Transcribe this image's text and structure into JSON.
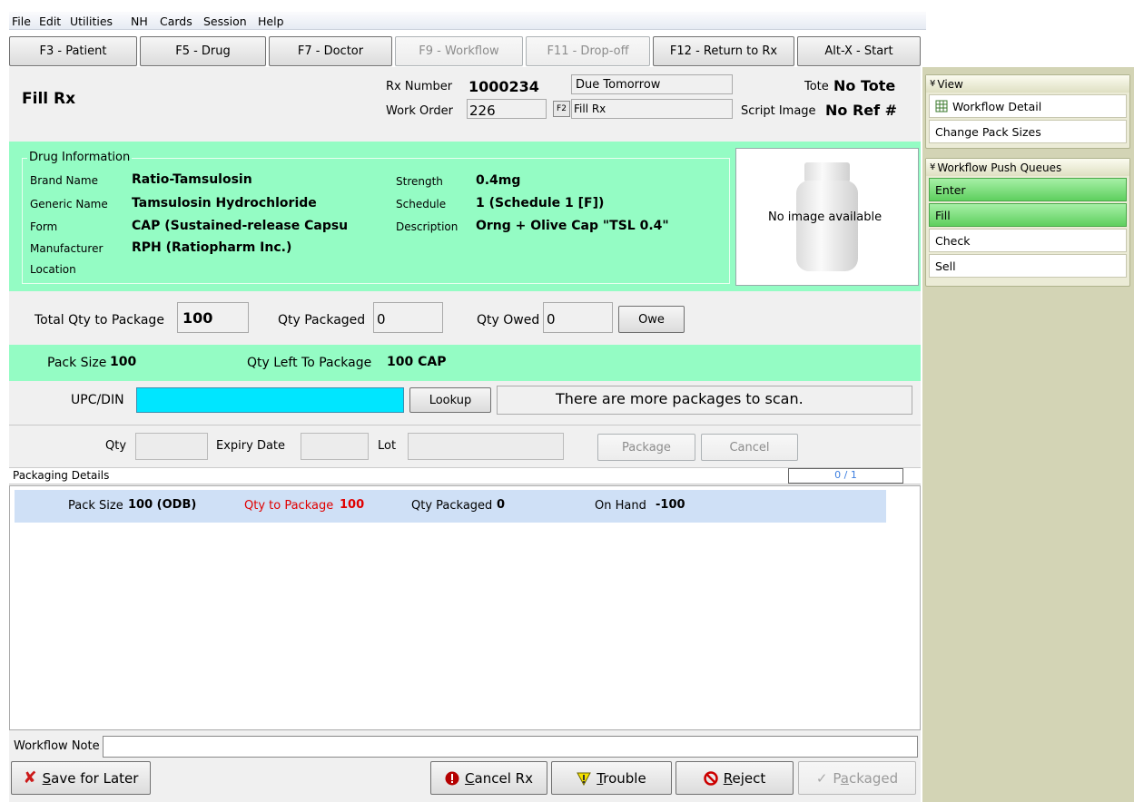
{
  "menu": [
    "File",
    "Edit",
    "Utilities",
    "NH",
    "Cards",
    "Session",
    "Help"
  ],
  "fkeys": [
    {
      "label": "F3 - Patient",
      "enabled": true
    },
    {
      "label": "F5 - Drug",
      "enabled": true
    },
    {
      "label": "F7 - Doctor",
      "enabled": true
    },
    {
      "label": "F9 - Workflow",
      "enabled": false
    },
    {
      "label": "F11 - Drop-off",
      "enabled": false
    },
    {
      "label": "F12 - Return to Rx",
      "enabled": true
    },
    {
      "label": "Alt-X - Start",
      "enabled": true
    }
  ],
  "header": {
    "title": "Fill Rx",
    "rx_number_label": "Rx Number",
    "rx_number": "1000234",
    "due": "Due Tomorrow",
    "work_order_label": "Work Order",
    "work_order": "226",
    "f2_key": "F2",
    "status": "Fill Rx",
    "tote_label": "Tote",
    "tote": "No Tote",
    "script_image_label": "Script Image",
    "script_image": "No Ref #"
  },
  "drug": {
    "section_title": "Drug Information",
    "brand_label": "Brand Name",
    "brand": "Ratio-Tamsulosin",
    "generic_label": "Generic Name",
    "generic": "Tamsulosin Hydrochloride",
    "form_label": "Form",
    "form": "CAP (Sustained-release Capsu",
    "manufacturer_label": "Manufacturer",
    "manufacturer": "RPH (Ratiopharm Inc.)",
    "location_label": "Location",
    "strength_label": "Strength",
    "strength": "0.4mg",
    "schedule_label": "Schedule",
    "schedule": "1 (Schedule 1 [F])",
    "description_label": "Description",
    "description": "Orng + Olive Cap \"TSL 0.4\"",
    "image_text": "No image available"
  },
  "qty": {
    "total_label": "Total Qty to Package",
    "total": "100",
    "packaged_label": "Qty Packaged",
    "packaged": "0",
    "owed_label": "Qty Owed",
    "owed": "0",
    "owe_button": "Owe"
  },
  "pack": {
    "size_label": "Pack Size",
    "size": "100",
    "left_label": "Qty Left To Package",
    "left": "100 CAP"
  },
  "scan": {
    "upc_label": "UPC/DIN",
    "upc_value": "",
    "lookup_button": "Lookup",
    "message": "There are more packages to scan."
  },
  "entry": {
    "qty_label": "Qty",
    "expiry_label": "Expiry Date",
    "lot_label": "Lot",
    "package_button": "Package",
    "cancel_button": "Cancel"
  },
  "details": {
    "title": "Packaging Details",
    "progress": "0 / 1",
    "progress_fraction": 0,
    "rows": [
      {
        "pack_label": "Pack Size",
        "pack": "100 (ODB)",
        "qty_label": "Qty to Package",
        "qty": "100",
        "packaged_label": "Qty Packaged",
        "packaged": "0",
        "onhand_label": "On Hand",
        "onhand": "-100"
      }
    ]
  },
  "note": {
    "label": "Workflow Note",
    "value": ""
  },
  "bottom": {
    "save_prefix": "S",
    "save_rest": "ave for Later",
    "cancel_prefix": "C",
    "cancel_rest": "ancel Rx",
    "trouble_prefix": "T",
    "trouble_rest": "rouble",
    "reject_prefix": "R",
    "reject_rest": "eject",
    "packaged_pre": "P",
    "packaged_u": "a",
    "packaged_rest": "ckaged"
  },
  "side": {
    "view_title": "View",
    "view_items": [
      "Workflow Detail",
      "Change Pack Sizes"
    ],
    "queues_title": "Workflow Push Queues",
    "queues": [
      {
        "label": "Enter",
        "active": true
      },
      {
        "label": "Fill",
        "active": true
      },
      {
        "label": "Check",
        "active": false
      },
      {
        "label": "Sell",
        "active": false
      }
    ]
  },
  "colors": {
    "green_band": "#94fcc4",
    "cyan_input": "#00e6ff",
    "row_highlight": "#cfe0f6",
    "red": "#e00000",
    "blue_progress": "#3d7fe0"
  }
}
